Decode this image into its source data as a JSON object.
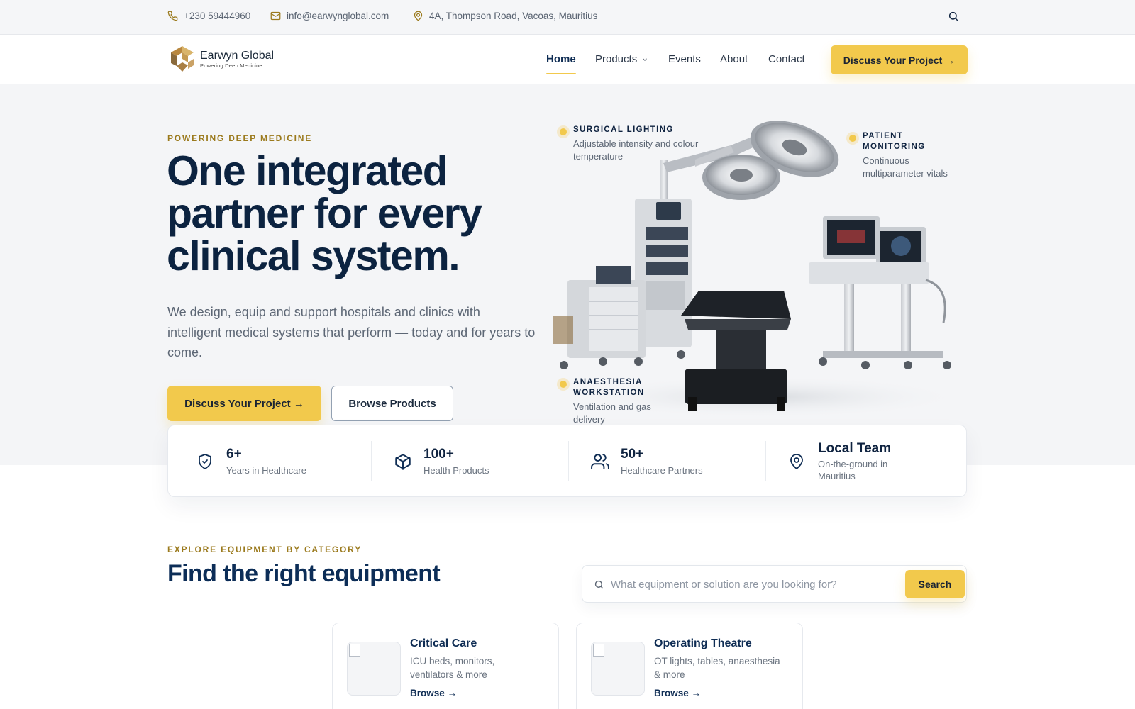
{
  "topbar": {
    "phone": "+230 59444960",
    "email": "info@earwynglobal.com",
    "address": "4A, Thompson Road, Vacoas, Mauritius"
  },
  "brand": {
    "name": "Earwyn Global",
    "tagline": "Powering Deep Medicine"
  },
  "nav": {
    "items": [
      {
        "label": "Home",
        "active": true
      },
      {
        "label": "Products"
      },
      {
        "label": "Events"
      },
      {
        "label": "About"
      },
      {
        "label": "Contact"
      }
    ],
    "cta": "Discuss Your Project →"
  },
  "hero": {
    "eyebrow": "POWERING DEEP MEDICINE",
    "title": "One integrated partner for every clinical system.",
    "lead": "We design, equip and support hospitals and clinics with intelligent medical systems that perform — today and for years to come.",
    "primary_cta": "Discuss Your Project →",
    "secondary_cta": "Browse Products",
    "callouts": [
      {
        "title": "SURGICAL LIGHTING",
        "desc": "Adjustable intensity and colour temperature"
      },
      {
        "title": "PATIENT MONITORING",
        "desc": "Continuous multiparameter vitals"
      },
      {
        "title": "ANAESTHESIA WORKSTATION",
        "desc": "Ventilation and gas delivery"
      }
    ]
  },
  "stats": [
    {
      "value": "6+",
      "label": "Years in Healthcare",
      "icon": "shield-check-icon"
    },
    {
      "value": "100+",
      "label": "Health Products",
      "icon": "box-icon"
    },
    {
      "value": "50+",
      "label": "Healthcare Partners",
      "icon": "users-icon"
    },
    {
      "value": "Local Team",
      "label": "On-the-ground in Mauritius",
      "icon": "map-pin-icon"
    }
  ],
  "category": {
    "eyebrow": "EXPLORE EQUIPMENT BY CATEGORY",
    "title": "Find the right equipment",
    "search_placeholder": "What equipment or solution are you looking for?",
    "search_button": "Search",
    "cards": [
      {
        "title": "Critical Care",
        "desc": "ICU beds, monitors, ventilators & more",
        "link": "Browse →"
      },
      {
        "title": "Operating Theatre",
        "desc": "OT lights, tables, anaesthesia & more",
        "link": "Browse →"
      }
    ]
  },
  "colors": {
    "accent": "#f2c94c",
    "navy": "#0c2340",
    "eyebrow": "#9b7a1d",
    "hero_bg": "#f4f5f7"
  }
}
